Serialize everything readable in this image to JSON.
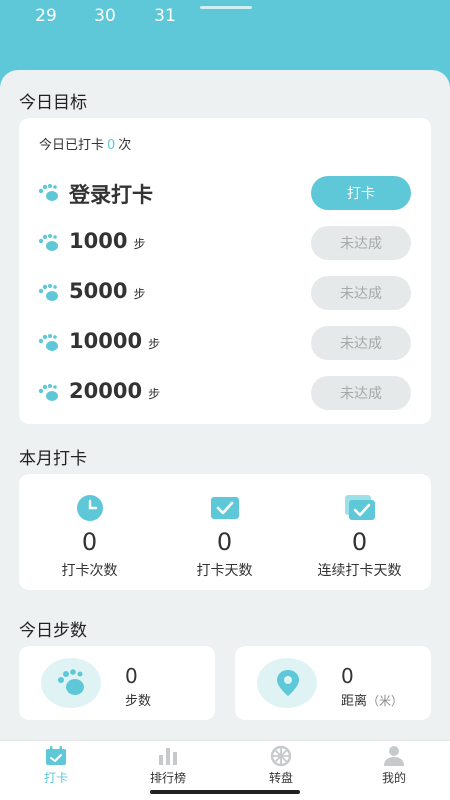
{
  "calendar": {
    "days": [
      "29",
      "30",
      "31"
    ]
  },
  "today_goal": {
    "title": "今日目标",
    "count_prefix": "今日已打卡",
    "count_value": "0",
    "count_suffix": "次",
    "rows": [
      {
        "label": "登录打卡",
        "unit": "",
        "button": "打卡",
        "state": "active"
      },
      {
        "label": "1000",
        "unit": "步",
        "button": "未达成",
        "state": "inactive"
      },
      {
        "label": "5000",
        "unit": "步",
        "button": "未达成",
        "state": "inactive"
      },
      {
        "label": "10000",
        "unit": "步",
        "button": "未达成",
        "state": "inactive"
      },
      {
        "label": "20000",
        "unit": "步",
        "button": "未达成",
        "state": "inactive"
      }
    ]
  },
  "month": {
    "title": "本月打卡",
    "stats": [
      {
        "value": "0",
        "label": "打卡次数",
        "icon": "clock-icon"
      },
      {
        "value": "0",
        "label": "打卡天数",
        "icon": "check-box-icon"
      },
      {
        "value": "0",
        "label": "连续打卡天数",
        "icon": "double-check-icon"
      }
    ]
  },
  "steps": {
    "title": "今日步数",
    "steps_value": "0",
    "steps_label": "步数",
    "distance_value": "0",
    "distance_label": "距离",
    "distance_unit": "（米）"
  },
  "tabs": [
    {
      "label": "打卡",
      "icon": "calendar-check-icon",
      "active": true
    },
    {
      "label": "排行榜",
      "icon": "bar-chart-icon",
      "active": false
    },
    {
      "label": "转盘",
      "icon": "wheel-icon",
      "active": false
    },
    {
      "label": "我的",
      "icon": "person-icon",
      "active": false
    }
  ],
  "colors": {
    "accent": "#5ec8d8",
    "inactive_button": "#e6e9ea",
    "background": "#eef1f1"
  }
}
